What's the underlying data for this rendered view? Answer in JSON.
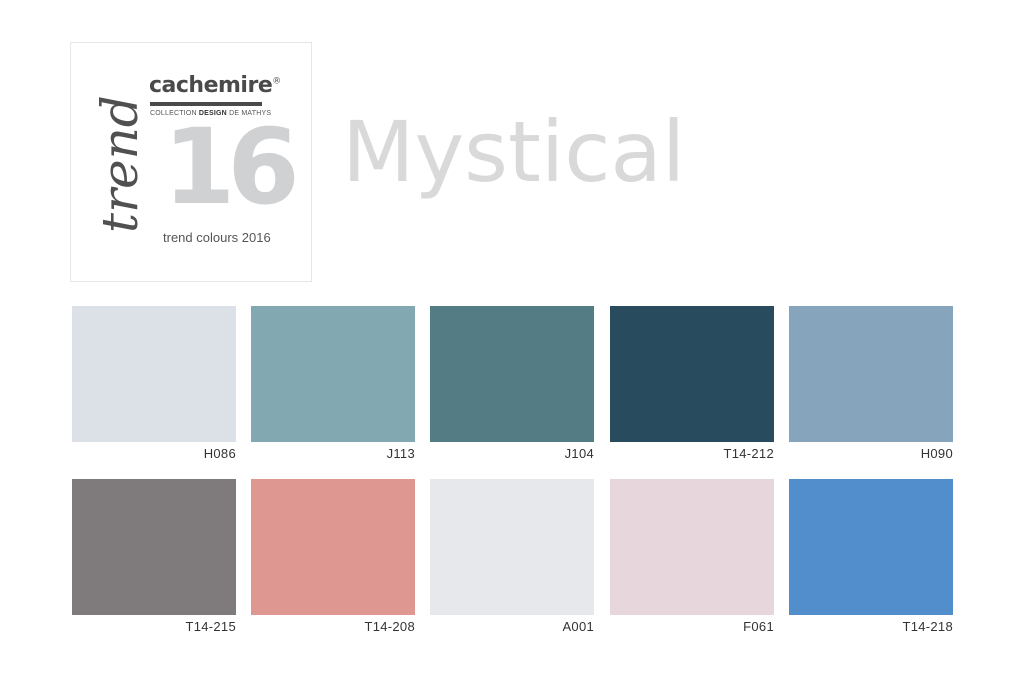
{
  "logo": {
    "brand": "cachemire",
    "trademark": "®",
    "subtitle_pre": "COLLECTION ",
    "subtitle_bold": "DESIGN",
    "subtitle_post": " DE MATHYS",
    "number": "16",
    "script_word": "trend",
    "tagline": "trend colours 2016"
  },
  "headline": "Mystical",
  "swatches": [
    {
      "code": "H086",
      "color": "#dce1e7"
    },
    {
      "code": "J113",
      "color": "#82a9b1"
    },
    {
      "code": "J104",
      "color": "#547c85"
    },
    {
      "code": "T14-212",
      "color": "#284c5e"
    },
    {
      "code": "H090",
      "color": "#87a4bd"
    },
    {
      "code": "T14-215",
      "color": "#7f7a7b"
    },
    {
      "code": "T14-208",
      "color": "#df9891"
    },
    {
      "code": "A001",
      "color": "#e7e8ec"
    },
    {
      "code": "F061",
      "color": "#e7d6db"
    },
    {
      "code": "T14-218",
      "color": "#538ecc"
    }
  ]
}
